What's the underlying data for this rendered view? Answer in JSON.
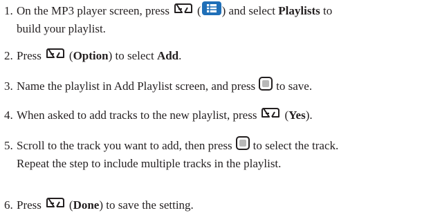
{
  "steps": [
    {
      "num": "1.",
      "t1": "On the MP3 player screen, press",
      "t2": "(",
      "t3": ") and select",
      "b1": "Playlists",
      "t4": "to",
      "t5": "build your playlist."
    },
    {
      "num": "2.",
      "t1": "Press",
      "t2": "(",
      "b1": "Option",
      "t3": ") to select",
      "b2": "Add",
      "t4": "."
    },
    {
      "num": "3.",
      "t1": "Name the playlist in Add Playlist screen, and press",
      "t2": "to save."
    },
    {
      "num": "4.",
      "t1": "When asked to add tracks to the new playlist, press",
      "t2": "(",
      "b1": "Yes",
      "t3": ")."
    },
    {
      "num": "5.",
      "t1": "Scroll to the track you want to add, then press",
      "t2": "to select the track.",
      "t3": "Repeat the step to include multiple tracks in the playlist."
    },
    {
      "num": "6.",
      "t1": "Press",
      "t2": "(",
      "b1": "Done",
      "t3": ") to save the setting."
    }
  ],
  "icons": {
    "soft_key": "left-soft-key-icon",
    "menu": "menu-list-icon",
    "center": "center-select-key-icon"
  },
  "colors": {
    "text": "#231f20",
    "menu_icon": "#1f6fb8"
  }
}
